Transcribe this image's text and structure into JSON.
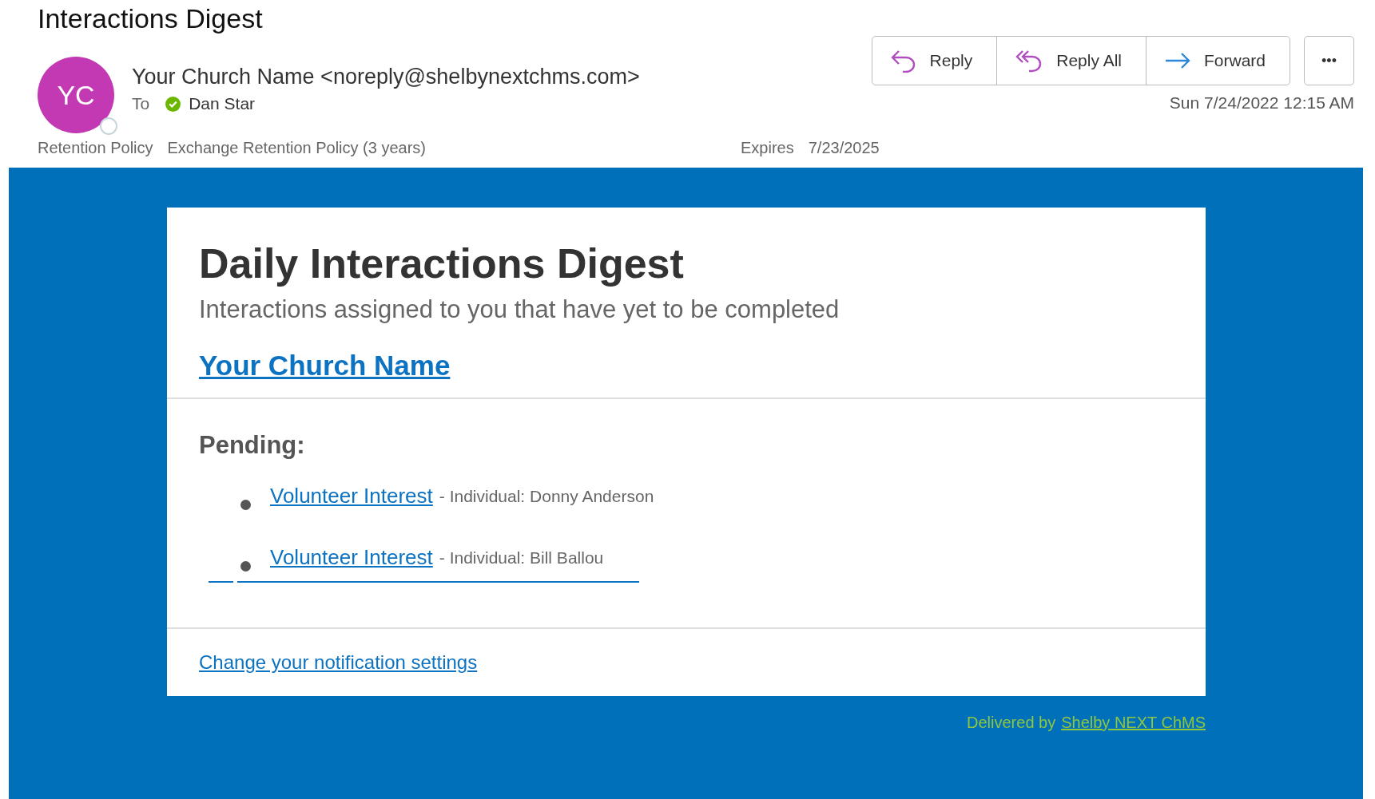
{
  "window": {
    "title": "Interactions Digest"
  },
  "message": {
    "avatar_initials": "YC",
    "sender": "Your Church Name <noreply@shelbynextchms.com>",
    "to_label": "To",
    "recipient": "Dan Star",
    "date": "Sun 7/24/2022 12:15 AM",
    "retention_label": "Retention Policy",
    "retention_value": "Exchange Retention Policy (3 years)",
    "expires_label": "Expires",
    "expires_value": "7/23/2025"
  },
  "actions": [
    {
      "kind": "reply",
      "label": "Reply"
    },
    {
      "kind": "reply_all",
      "label": "Reply All"
    },
    {
      "kind": "forward",
      "label": "Forward"
    }
  ],
  "more_button": "•••",
  "email": {
    "heading": "Daily Interactions Digest",
    "subheading": "Interactions assigned to you that have yet to be completed",
    "church_link": "Your Church Name",
    "section_title": "Pending:",
    "items": [
      {
        "link": "Volunteer Interest",
        "detail": "- Individual: Donny Anderson"
      },
      {
        "link": "Volunteer Interest",
        "detail": "- Individual: Bill Ballou"
      }
    ],
    "settings_link": "Change your notification settings",
    "delivered_by": "Delivered by",
    "delivered_link": "Shelby NEXT ChMS"
  }
}
